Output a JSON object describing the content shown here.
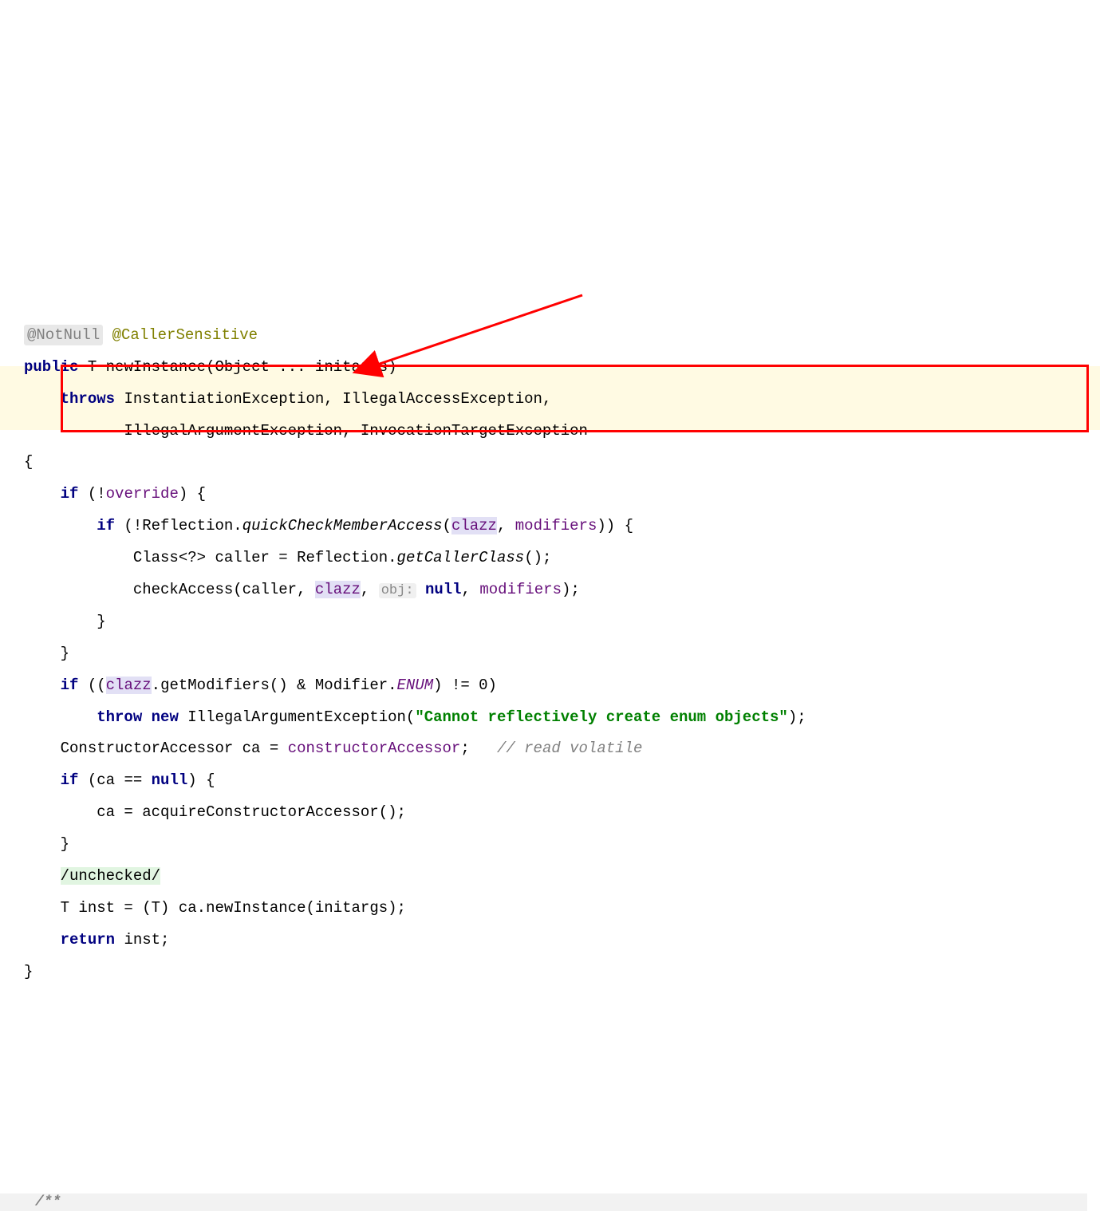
{
  "annotations": {
    "notNull": "@NotNull",
    "callerSensitive": "@CallerSensitive"
  },
  "tokens": {
    "public": "public",
    "T": "T",
    "newInstance": "newInstance",
    "Object": "Object",
    "varargs": "...",
    "initargs": "initargs",
    "throws": "throws",
    "InstantiationException": "InstantiationException",
    "IllegalAccessException": "IllegalAccessException",
    "IllegalArgumentException": "IllegalArgumentException",
    "InvocationTargetException": "InvocationTargetException",
    "if": "if",
    "override": "override",
    "Reflection": "Reflection",
    "quickCheckMemberAccess": "quickCheckMemberAccess",
    "clazz": "clazz",
    "modifiers": "modifiers",
    "Class": "Class",
    "wildcard": "<?>",
    "caller": "caller",
    "getCallerClass": "getCallerClass",
    "checkAccess": "checkAccess",
    "objHint": "obj:",
    "null": "null",
    "getModifiers": "getModifiers",
    "Modifier": "Modifier",
    "ENUM": "ENUM",
    "throw": "throw",
    "new": "new",
    "enumErrorString": "\"Cannot reflectively create enum objects\"",
    "ConstructorAccessor": "ConstructorAccessor",
    "ca": "ca",
    "constructorAccessor": "constructorAccessor",
    "readVolatileComment": "// read volatile",
    "acquireConstructorAccessor": "acquireConstructorAccessor",
    "suppressUnchecked": "/unchecked/",
    "inst": "inst",
    "return": "return",
    "javadocStart": "/**"
  }
}
